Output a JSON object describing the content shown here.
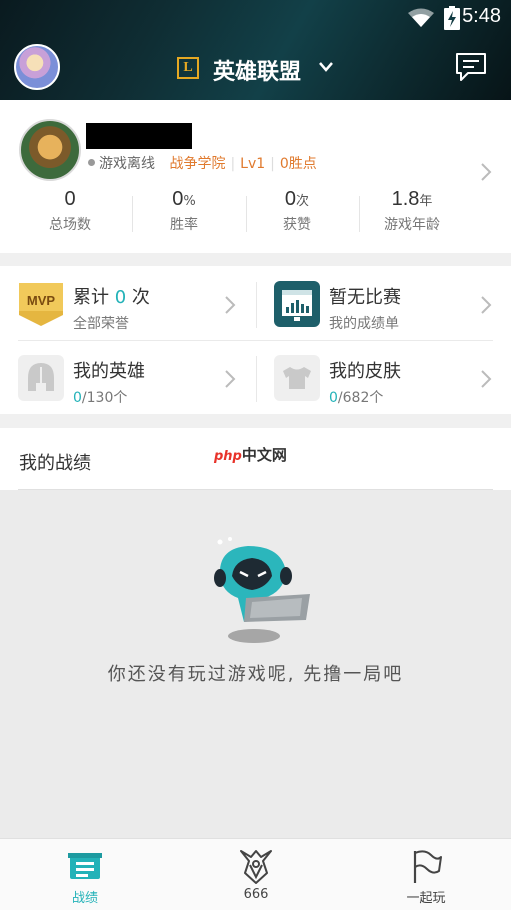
{
  "status_bar": {
    "time": "5:48"
  },
  "header": {
    "title": "英雄联盟",
    "logo_letter": "L"
  },
  "profile": {
    "online_status": "游戏离线",
    "tags": [
      "战争学院",
      "Lv1",
      "0胜点"
    ],
    "stats": [
      {
        "value": "0",
        "unit": "",
        "label": "总场数"
      },
      {
        "value": "0",
        "unit": "%",
        "label": "胜率"
      },
      {
        "value": "0",
        "unit": "次",
        "label": "获赞"
      },
      {
        "value": "1.8",
        "unit": "年",
        "label": "游戏年龄"
      }
    ]
  },
  "honors": {
    "mvp": {
      "badge": "MVP",
      "prefix": "累计",
      "count": "0",
      "suffix": "次",
      "subtitle": "全部荣誉"
    },
    "match": {
      "title": "暂无比赛",
      "subtitle": "我的成绩单"
    },
    "heroes": {
      "title": "我的英雄",
      "owned": "0",
      "total": "/130个"
    },
    "skins": {
      "title": "我的皮肤",
      "owned": "0",
      "total": "/682个"
    }
  },
  "records": {
    "title": "我的战绩",
    "watermark_php": "php",
    "watermark_text": "中文网",
    "empty_message": "你还没有玩过游戏呢, 先撸一局吧"
  },
  "bottom_nav": [
    {
      "label": "战绩",
      "icon": "record-icon",
      "active": true
    },
    {
      "label": "666",
      "icon": "lol-crest-icon",
      "active": false
    },
    {
      "label": "一起玩",
      "icon": "flag-icon",
      "active": false
    }
  ],
  "colors": {
    "accent": "#23b2b8",
    "tag": "#e07a2e",
    "mvp_gold": "#e5b640",
    "match_teal": "#1e5f6a"
  }
}
